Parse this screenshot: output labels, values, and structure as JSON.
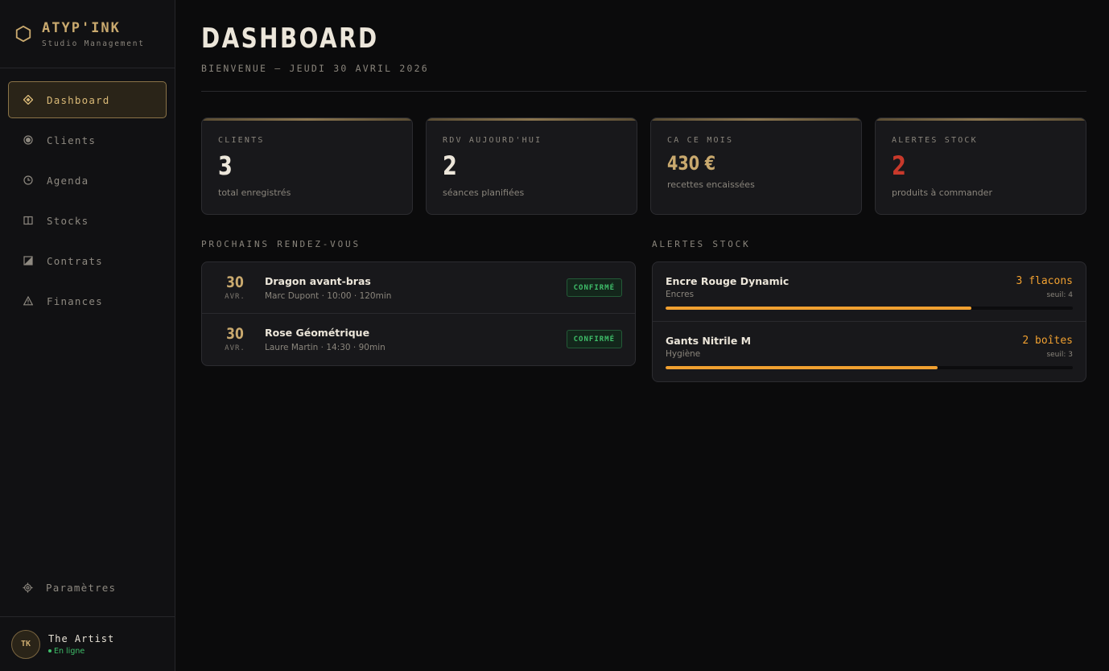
{
  "brand": {
    "name": "ATYP'INK",
    "subtitle": "Studio Management"
  },
  "nav": {
    "items": [
      {
        "label": "Dashboard",
        "icon": "diamond-icon",
        "active": true
      },
      {
        "label": "Clients",
        "icon": "circle-icon",
        "active": false
      },
      {
        "label": "Agenda",
        "icon": "clock-icon",
        "active": false
      },
      {
        "label": "Stocks",
        "icon": "book-icon",
        "active": false
      },
      {
        "label": "Contrats",
        "icon": "contract-icon",
        "active": false
      },
      {
        "label": "Finances",
        "icon": "warning-icon",
        "active": false
      }
    ],
    "settings_label": "Paramètres"
  },
  "user": {
    "initials": "TK",
    "name": "The Artist",
    "status": "En ligne"
  },
  "header": {
    "title": "DASHBOARD",
    "subtitle": "BIENVENUE — JEUDI 30 AVRIL 2026"
  },
  "stats": [
    {
      "label": "CLIENTS",
      "value": "3",
      "desc": "total enregistrés",
      "color": "#ece6da"
    },
    {
      "label": "RDV AUJOURD'HUI",
      "value": "2",
      "desc": "séances planifiées",
      "color": "#ece6da"
    },
    {
      "label": "CA CE MOIS",
      "value": "430 €",
      "desc": "recettes encaissées",
      "color": "#c9a96e"
    },
    {
      "label": "ALERTES STOCK",
      "value": "2",
      "desc": "produits à commander",
      "color": "#c8392b"
    }
  ],
  "appointments": {
    "title": "PROCHAINS RENDEZ-VOUS",
    "items": [
      {
        "day": "30",
        "month": "AVR.",
        "title": "Dragon avant-bras",
        "meta": "Marc Dupont · 10:00 · 120min",
        "status": "CONFIRMÉ"
      },
      {
        "day": "30",
        "month": "AVR.",
        "title": "Rose Géométrique",
        "meta": "Laure Martin · 14:30 · 90min",
        "status": "CONFIRMÉ"
      }
    ]
  },
  "stock_alerts": {
    "title": "ALERTES STOCK",
    "items": [
      {
        "name": "Encre Rouge Dynamic",
        "category": "Encres",
        "quantity": "3 flacons",
        "threshold": "seuil: 4",
        "level": 0.75
      },
      {
        "name": "Gants Nitrile M",
        "category": "Hygiène",
        "quantity": "2 boîtes",
        "threshold": "seuil: 3",
        "level": 0.667
      }
    ]
  },
  "colors": {
    "accent": "#c9a96e",
    "warning": "#f0a030",
    "danger": "#c8392b",
    "success": "#3fbf6a"
  }
}
